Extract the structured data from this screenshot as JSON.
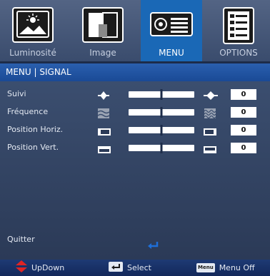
{
  "tabs": [
    {
      "label": "Luminosité",
      "icon": "luminosity-picture-icon",
      "active": false
    },
    {
      "label": "Image",
      "icon": "image-contrast-icon",
      "active": false
    },
    {
      "label": "MENU",
      "icon": "projector-menu-icon",
      "active": true
    },
    {
      "label": "OPTIONS",
      "icon": "options-list-icon",
      "active": false
    }
  ],
  "header": {
    "title": "MENU | SIGNAL"
  },
  "rows": [
    {
      "label": "Suivi",
      "value": "0",
      "icon_left": "tracking-narrow-icon",
      "icon_right": "tracking-wide-icon",
      "level": 0.5
    },
    {
      "label": "Fréquence",
      "value": "0",
      "icon_left": "frequency-low-icon",
      "icon_right": "frequency-high-icon",
      "level": 0.5
    },
    {
      "label": "Position Horiz.",
      "value": "0",
      "icon_left": "horizontal-left-icon",
      "icon_right": "horizontal-right-icon",
      "level": 0.5
    },
    {
      "label": "Position Vert.",
      "value": "0",
      "icon_left": "vertical-down-icon",
      "icon_right": "vertical-up-icon",
      "level": 0.5
    }
  ],
  "quit": {
    "label": "Quitter"
  },
  "footer": {
    "updown": "UpDown",
    "select": "Select",
    "menu_key": "Menu",
    "menu_off": "Menu Off"
  },
  "colors": {
    "active_tab": "#1a68b6",
    "header": "#1a4a96",
    "footer": "#13285a",
    "accent_red": "#e02424"
  }
}
